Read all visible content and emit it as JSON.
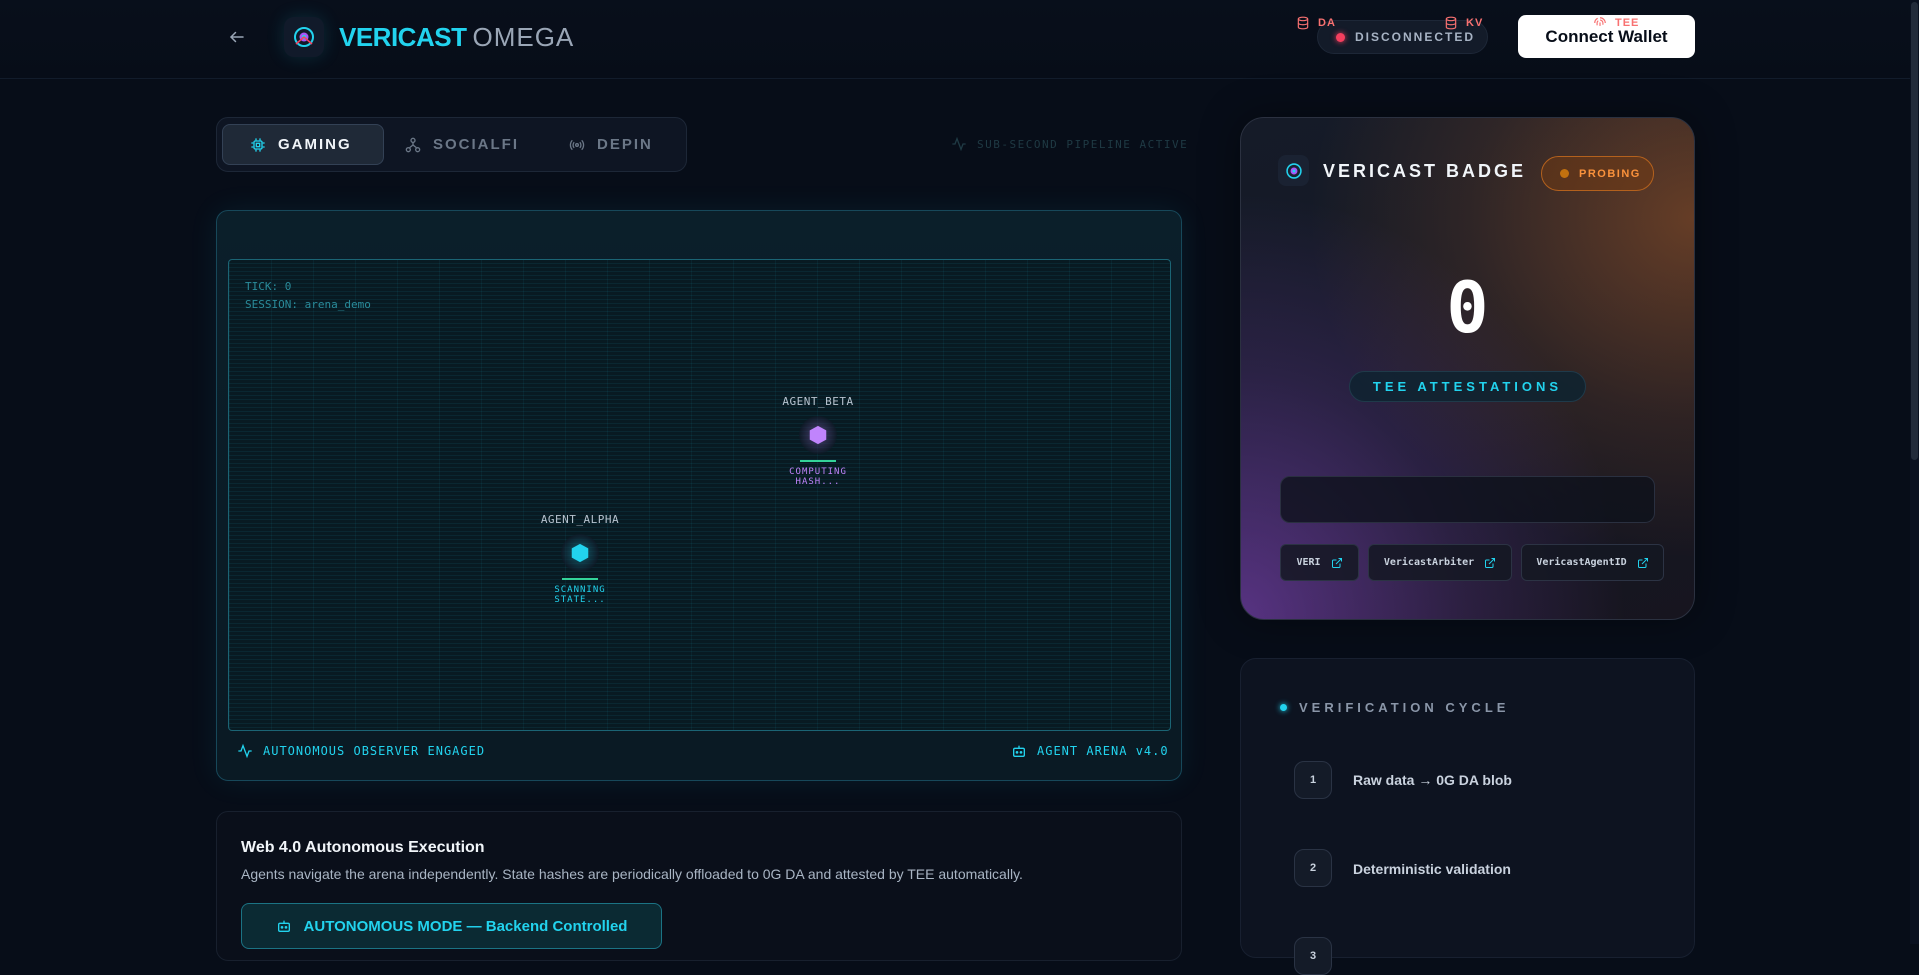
{
  "header": {
    "brand_primary": "VERICAST",
    "brand_secondary": "OMEGA",
    "connection_status": "DISCONNECTED",
    "connect_label": "Connect Wallet"
  },
  "tabs": [
    {
      "label": "GAMING",
      "icon": "chip-icon",
      "active": true
    },
    {
      "label": "SOCIALFI",
      "icon": "network-icon",
      "active": false
    },
    {
      "label": "DEPIN",
      "icon": "broadcast-icon",
      "active": false
    }
  ],
  "pipeline_status": "SUB-SECOND PIPELINE ACTIVE",
  "arena": {
    "tick": "TICK: 0",
    "session": "SESSION: arena_demo",
    "agents": [
      {
        "name": "AGENT_BETA",
        "state": "COMPUTING HASH...",
        "color": "#c084fc"
      },
      {
        "name": "AGENT_ALPHA",
        "state": "SCANNING STATE...",
        "color": "#22d3ee"
      }
    ],
    "footer_left": "AUTONOMOUS OBSERVER ENGAGED",
    "footer_right": "AGENT ARENA v4.0"
  },
  "execution": {
    "title": "Web 4.0 Autonomous Execution",
    "description": "Agents navigate the arena independently. State hashes are periodically offloaded to 0G DA and attested by TEE automatically.",
    "mode_button": "AUTONOMOUS MODE — Backend Controlled"
  },
  "badge": {
    "title": "VERICAST BADGE",
    "status": "PROBING",
    "count": "0",
    "count_label": "TEE ATTESTATIONS",
    "layers": [
      "DA",
      "KV",
      "TEE"
    ],
    "contracts": [
      "VERI",
      "VericastArbiter",
      "VericastAgentID"
    ]
  },
  "verification": {
    "title": "VERIFICATION CYCLE",
    "steps": [
      {
        "num": "1",
        "text": "Raw data → 0G DA blob"
      },
      {
        "num": "2",
        "text": "Deterministic validation"
      },
      {
        "num": "3",
        "text": ""
      }
    ]
  },
  "colors": {
    "accent": "#22d3ee",
    "disconnected": "#f43f5e",
    "probing": "#fb923c",
    "layer": "#f87171",
    "agent_beta": "#c084fc"
  }
}
